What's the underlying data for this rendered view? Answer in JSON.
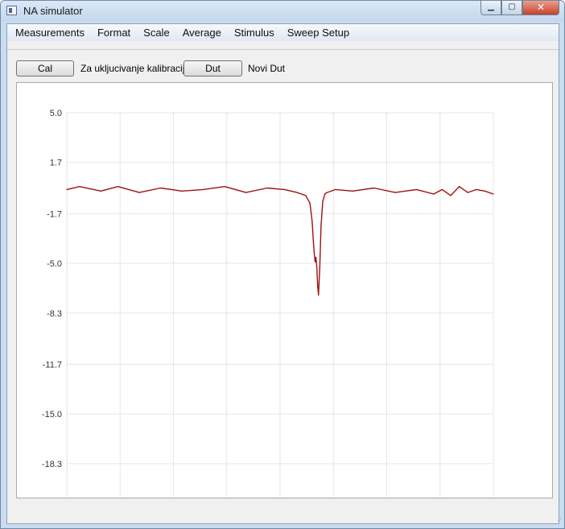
{
  "window": {
    "title": "NA simulator",
    "min_glyph": "▁",
    "max_glyph": "▢",
    "close_glyph": "✕"
  },
  "menu": [
    "Measurements",
    "Format",
    "Scale",
    "Average",
    "Stimulus",
    "Sweep Setup"
  ],
  "toolbar": {
    "cal_label": "Cal",
    "cal_text": "Za ukljucivanje kalibracije",
    "dut_label": "Dut",
    "dut_text": "Novi Dut"
  },
  "chart_data": {
    "type": "line",
    "title": "",
    "xlabel": "",
    "ylabel": "",
    "grid": true,
    "ylim": [
      -20.5,
      5.0
    ],
    "xlim": [
      0,
      1
    ],
    "y_ticks": [
      "5.0",
      "1.7",
      "-1.7",
      "-5.0",
      "-8.3",
      "-11.7",
      "-15.0",
      "-18.3"
    ],
    "y_tick_values": [
      5.0,
      1.7,
      -1.7,
      -5.0,
      -8.3,
      -11.7,
      -15.0,
      -18.3
    ],
    "x_grid_count": 9,
    "line_color": "#a01010",
    "series": [
      {
        "x": [
          0,
          0.03,
          0.08,
          0.12,
          0.17,
          0.22,
          0.27,
          0.32,
          0.37,
          0.42,
          0.47,
          0.51,
          0.54,
          0.56,
          0.57,
          0.575,
          0.578,
          0.58,
          0.582,
          0.584,
          0.586,
          0.588,
          0.59,
          0.593,
          0.596,
          0.6,
          0.605,
          0.61,
          0.63,
          0.67,
          0.72,
          0.77,
          0.82,
          0.86,
          0.88,
          0.9,
          0.92,
          0.94,
          0.96,
          0.98,
          1.0
        ],
        "y": [
          -0.1,
          0.1,
          -0.2,
          0.1,
          -0.3,
          0.0,
          -0.2,
          -0.1,
          0.1,
          -0.3,
          0.0,
          -0.1,
          -0.3,
          -0.5,
          -1.0,
          -2.2,
          -3.5,
          -4.3,
          -4.9,
          -4.6,
          -5.2,
          -6.4,
          -7.1,
          -5.3,
          -2.5,
          -0.9,
          -0.4,
          -0.3,
          -0.1,
          -0.2,
          0.0,
          -0.3,
          -0.1,
          -0.4,
          -0.1,
          -0.5,
          0.1,
          -0.3,
          -0.1,
          -0.2,
          -0.4
        ]
      }
    ]
  }
}
